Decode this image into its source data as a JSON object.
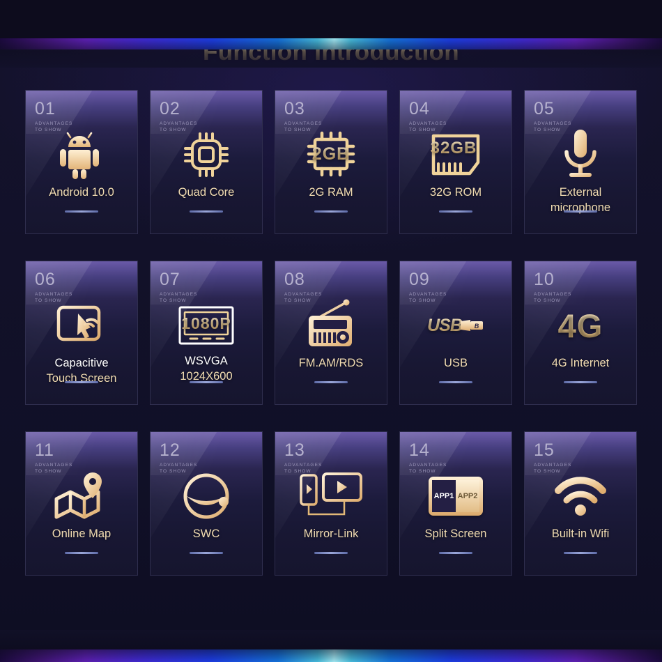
{
  "page": {
    "title": "Function Introduction",
    "card_subtitle_line1": "ADVANTAGES",
    "card_subtitle_line2": "TO SHOW",
    "colors": {
      "gold": "#f1dcb2",
      "background": "#0d0c1d",
      "card_top": "#6a5aa8",
      "rule": "#9aa6d8",
      "number": "#c3bfd8"
    }
  },
  "cards": [
    {
      "num": "01",
      "label": "Android 10.0",
      "icon": "android-icon",
      "icon_text": ""
    },
    {
      "num": "02",
      "label": "Quad Core",
      "icon": "cpu-chip-icon",
      "icon_text": ""
    },
    {
      "num": "03",
      "label": "2G RAM",
      "icon": "memory-chip-icon",
      "icon_text": "2GB"
    },
    {
      "num": "04",
      "label": "32G ROM",
      "icon": "sd-card-icon",
      "icon_text": "32GB"
    },
    {
      "num": "05",
      "label_line1": "External",
      "label_line2": "microphone",
      "label": "External microphone",
      "icon": "microphone-icon",
      "icon_text": ""
    },
    {
      "num": "06",
      "label_line1": "Capacitive",
      "label_line2": "Touch Screen",
      "label": "Capacitive Touch Screen",
      "icon": "touch-screen-icon",
      "icon_text": ""
    },
    {
      "num": "07",
      "label_line1": "WSVGA",
      "label_line2": "1024X600",
      "label": "WSVGA 1024X600",
      "icon": "monitor-icon",
      "icon_text": "1080P"
    },
    {
      "num": "08",
      "label": "FM.AM/RDS",
      "icon": "radio-icon",
      "icon_text": ""
    },
    {
      "num": "09",
      "label": "USB",
      "icon": "usb-logo-icon",
      "icon_text": "USB"
    },
    {
      "num": "10",
      "label": "4G Internet",
      "icon": "four-g-icon",
      "icon_text": "4G"
    },
    {
      "num": "11",
      "label": "Online Map",
      "icon": "map-pin-icon",
      "icon_text": ""
    },
    {
      "num": "12",
      "label": "SWC",
      "icon": "steering-wheel-icon",
      "icon_text": ""
    },
    {
      "num": "13",
      "label": "Mirror-Link",
      "icon": "mirror-link-icon",
      "icon_text": ""
    },
    {
      "num": "14",
      "label": "Split Screen",
      "icon": "split-screen-icon",
      "icon_text": "APP1 APP2",
      "app1": "APP1",
      "app2": "APP2"
    },
    {
      "num": "15",
      "label": "Built-in Wifi",
      "icon": "wifi-icon",
      "icon_text": ""
    }
  ]
}
